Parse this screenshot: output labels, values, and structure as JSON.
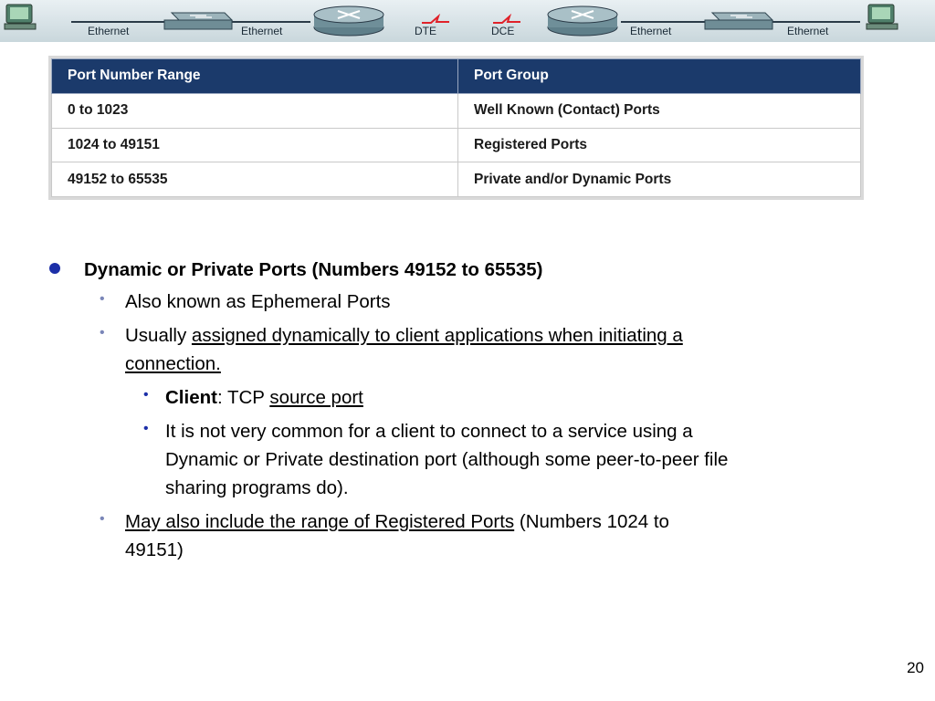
{
  "banner": {
    "labels": [
      "Ethernet",
      "Ethernet",
      "DTE",
      "DCE",
      "Ethernet",
      "Ethernet"
    ]
  },
  "table": {
    "headers": [
      "Port Number Range",
      "Port Group"
    ],
    "rows": [
      [
        "0 to 1023",
        "Well Known (Contact) Ports"
      ],
      [
        "1024 to 49151",
        "Registered Ports"
      ],
      [
        "49152 to 65535",
        "Private and/or Dynamic Ports"
      ]
    ]
  },
  "bullets": {
    "main": "Dynamic or Private Ports (Numbers 49152 to 65535)",
    "b1": "Also known as Ephemeral Ports",
    "b2_prefix": "Usually ",
    "b2_link1": "assigned dynamically to client applications when initiating a",
    "b2_link2": "connection.",
    "b3_bold": "Client",
    "b3_text": ": TCP ",
    "b3_link": "source port",
    "b4_line1": "It is not very common for a client to connect to a service using a",
    "b4_line2": "Dynamic or Private destination port (although some peer-to-peer file",
    "b4_line3": "sharing programs do).",
    "b5_link": "May also include the range of Registered Ports",
    "b5_text": " (Numbers 1024 to",
    "b5_line2": "49151)"
  },
  "page_number": "20",
  "colors": {
    "header_bg": "#1b3a6b",
    "bullet": "#1c2fa8"
  }
}
